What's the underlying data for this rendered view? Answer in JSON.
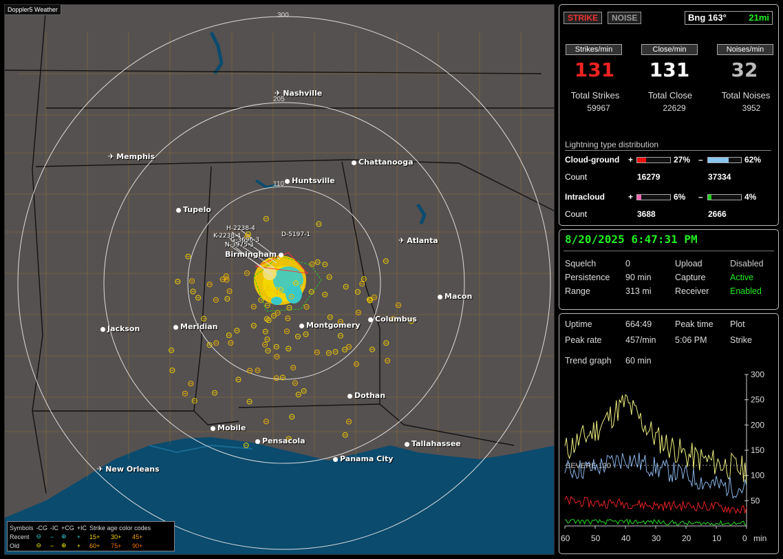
{
  "map": {
    "title": "Doppler5 Weather",
    "ring_labels": [
      "300",
      "205",
      "110"
    ],
    "cities": [
      {
        "name": "Nashville",
        "icon": "airport-icon"
      },
      {
        "name": "Memphis",
        "icon": "airport-icon"
      },
      {
        "name": "Chattanooga",
        "icon": "city-dot"
      },
      {
        "name": "Huntsville",
        "icon": "city-dot"
      },
      {
        "name": "Tupelo",
        "icon": "city-dot"
      },
      {
        "name": "Atlanta",
        "icon": "airport-icon"
      },
      {
        "name": "Birmingham",
        "icon": "city-dot"
      },
      {
        "name": "Macon",
        "icon": "city-dot"
      },
      {
        "name": "Jackson",
        "icon": "city-dot"
      },
      {
        "name": "Meridian",
        "icon": "city-dot"
      },
      {
        "name": "Montgomery",
        "icon": "city-dot"
      },
      {
        "name": "Columbus",
        "icon": "city-dot"
      },
      {
        "name": "Dothan",
        "icon": "city-dot"
      },
      {
        "name": "Mobile",
        "icon": "city-dot"
      },
      {
        "name": "Pensacola",
        "icon": "city-dot"
      },
      {
        "name": "Tallahassee",
        "icon": "city-dot"
      },
      {
        "name": "Panama City",
        "icon": "city-dot"
      },
      {
        "name": "New Orleans",
        "icon": "airport-icon"
      }
    ],
    "storm_labels": [
      "H-2238-4",
      "K-2238-4",
      "D-5197-1",
      "N-3975-3",
      "G-3696-3"
    ],
    "legend": {
      "header": [
        "Symbols",
        "-CG",
        "-IC",
        "+CG",
        "+IC",
        "Strike age color codes"
      ],
      "recent": {
        "label": "Recent",
        "ages": [
          "15+",
          "30+",
          "45+"
        ]
      },
      "old": {
        "label": "Old",
        "ages": [
          "60+",
          "75+",
          "90+"
        ]
      }
    }
  },
  "stats": {
    "strike_tag": "STRIKE",
    "noise_tag": "NOISE",
    "bearing": "Bng 163°",
    "distance": "21mi",
    "strikes_min_label": "Strikes/min",
    "close_min_label": "Close/min",
    "noises_min_label": "Noises/min",
    "strikes_min": "131",
    "close_min": "131",
    "noises_min": "32",
    "total_strikes_label": "Total Strikes",
    "total_close_label": "Total Close",
    "total_noises_label": "Total Noises",
    "total_strikes": "59967",
    "total_close": "22629",
    "total_noises": "3952",
    "dist_title": "Lightning type distribution",
    "cg_label": "Cloud-ground",
    "ic_label": "Intracloud",
    "count_label": "Count",
    "plus": "+",
    "minus": "–",
    "cg_pos_pct": "27%",
    "cg_neg_pct": "62%",
    "cg_pos_count": "16279",
    "cg_neg_count": "37334",
    "ic_pos_pct": "6%",
    "ic_neg_pct": "4%",
    "ic_pos_count": "3688",
    "ic_neg_count": "2666",
    "cg_pos_frac": 0.27,
    "cg_neg_frac": 0.62,
    "ic_pos_frac": 0.06,
    "ic_neg_frac": 0.04
  },
  "status": {
    "datetime": "8/20/2025 6:47:31 PM",
    "squelch_label": "Squelch",
    "squelch": "0",
    "persistence_label": "Persistence",
    "persistence": "90 min",
    "range_label": "Range",
    "range": "313 mi",
    "upload_label": "Upload",
    "upload": "Disabled",
    "capture_label": "Capture",
    "capture": "Active",
    "receiver_label": "Receiver",
    "receiver": "Enabled"
  },
  "trend": {
    "uptime_label": "Uptime",
    "uptime": "664:49",
    "peak_time_label": "Peak time",
    "plot_label": "Plot",
    "peak_rate_label": "Peak rate",
    "peak_rate": "457/min",
    "peak_time": "5:06 PM",
    "plot": "Strike",
    "trend_label": "Trend graph",
    "trend_value": "60 min",
    "severe_label": "SEVERE 120",
    "y_ticks": [
      "300",
      "250",
      "200",
      "150",
      "100",
      "50"
    ],
    "x_ticks": [
      "60",
      "50",
      "40",
      "30",
      "20",
      "10",
      "0"
    ],
    "x_unit": "min"
  },
  "chart_data": {
    "type": "line",
    "x": [
      60,
      50,
      40,
      30,
      20,
      10,
      0
    ],
    "xlabel": "min",
    "ylim": [
      0,
      300
    ],
    "severe_threshold": 120,
    "series": [
      {
        "color": "#f0f080",
        "values": [
          150,
          190,
          245,
          175,
          140,
          125,
          110
        ]
      },
      {
        "color": "#8ab4e8",
        "values": [
          110,
          115,
          135,
          115,
          100,
          80,
          75
        ]
      },
      {
        "color": "#ee2222",
        "values": [
          50,
          45,
          45,
          40,
          40,
          38,
          30
        ]
      },
      {
        "color": "#22dd22",
        "values": [
          10,
          8,
          8,
          8,
          5,
          5,
          5
        ]
      }
    ]
  },
  "colors": {
    "strike": "#ee2222",
    "close": "#ffffff",
    "noise": "#bbbbbb",
    "accent": "#22ee22"
  }
}
